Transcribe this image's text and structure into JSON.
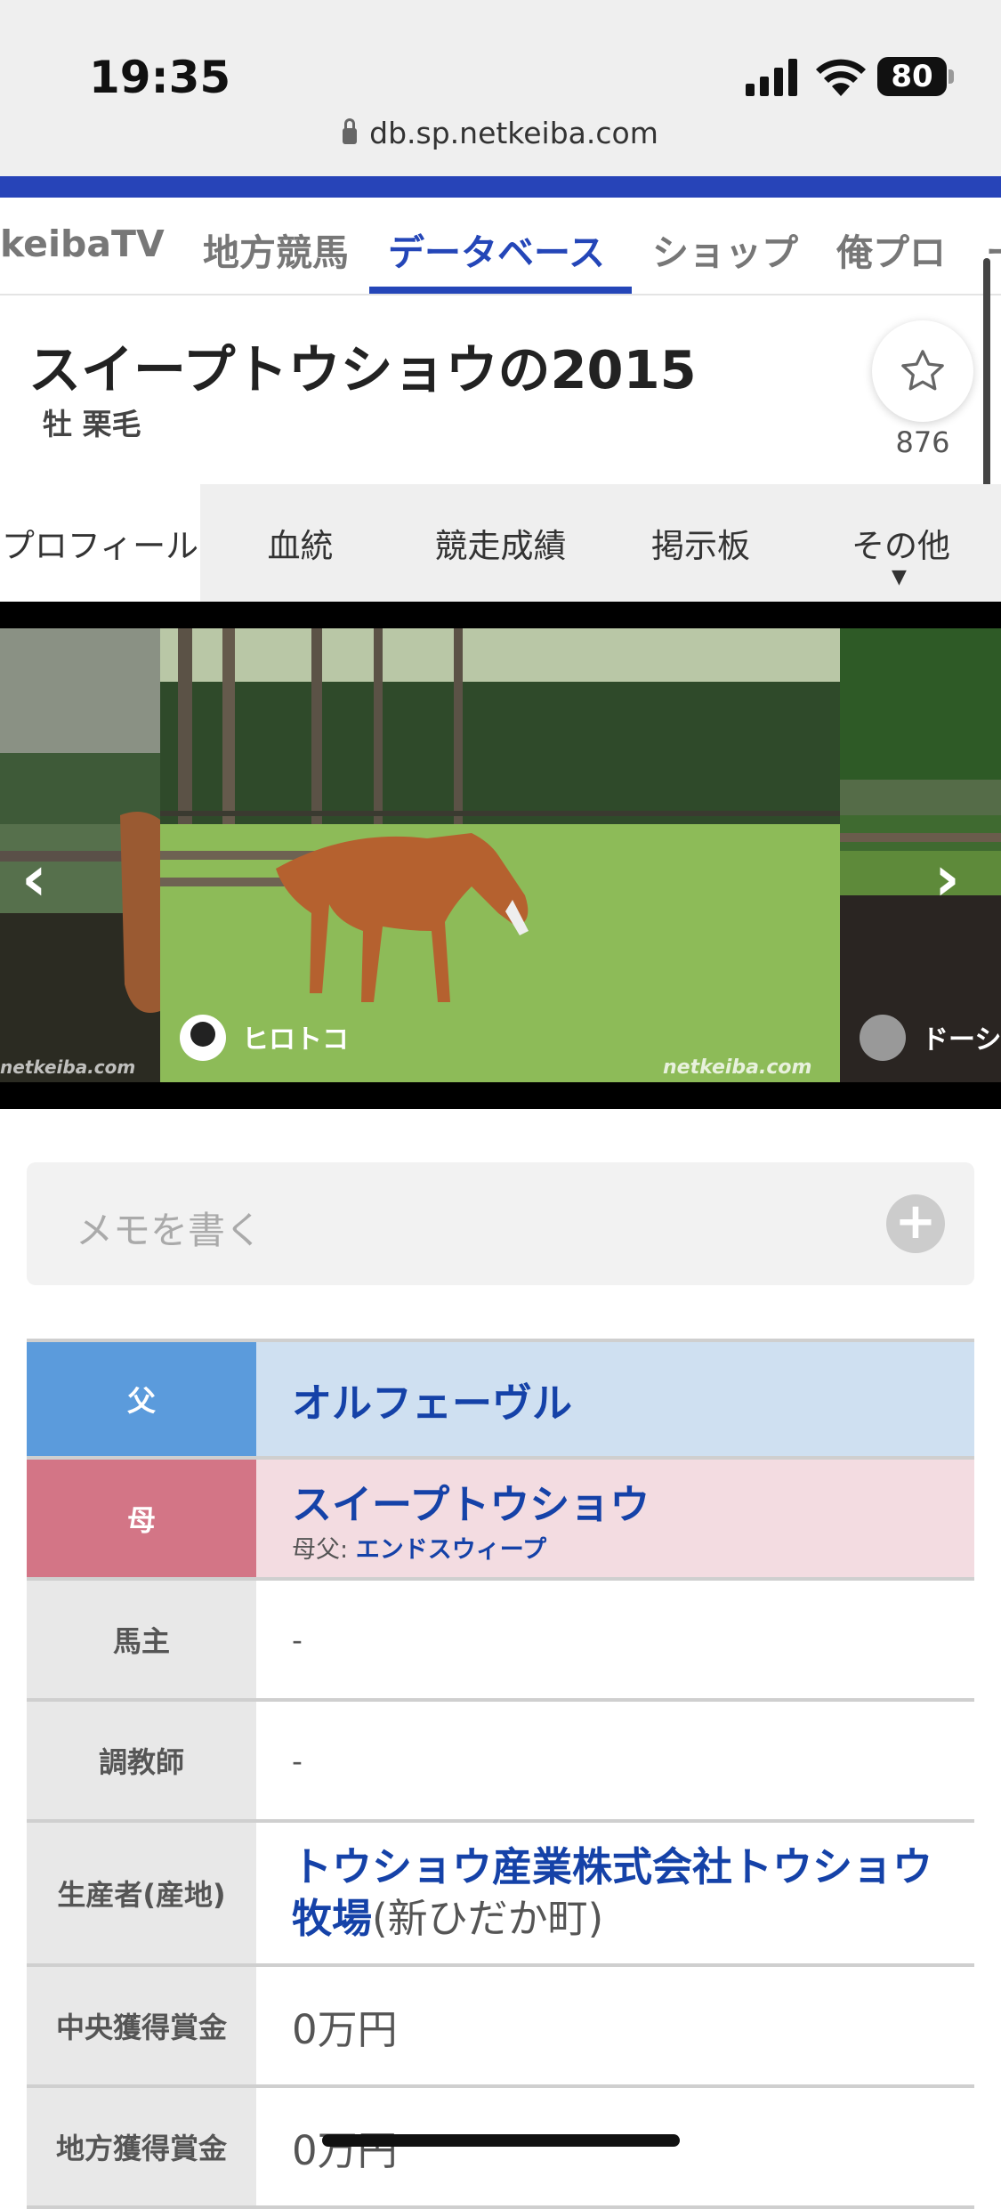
{
  "status": {
    "time": "19:35",
    "battery": "80",
    "url": "db.sp.netkeiba.com"
  },
  "global_nav": {
    "items": [
      "keibaTV",
      "地方競馬",
      "データベース",
      "ショップ",
      "俺プロ",
      "ー"
    ],
    "active": "データベース"
  },
  "horse": {
    "name": "スイープトウショウの2015",
    "sub": "牡  栗毛",
    "fav_count": "876"
  },
  "tabs": [
    "プロフィール",
    "血統",
    "競走成績",
    "掲示板",
    "その他"
  ],
  "gallery": {
    "center_user": "ヒロトコ",
    "right_user": "ドーシ",
    "watermark": "netkeiba.com"
  },
  "memo": {
    "placeholder": "メモを書く"
  },
  "profile": {
    "sire_label": "父",
    "sire": "オルフェーヴル",
    "dam_label": "母",
    "dam": "スイープトウショウ",
    "damsire_label": "母父:",
    "damsire": "エンドスウィープ",
    "owner_label": "馬主",
    "owner": "-",
    "trainer_label": "調教師",
    "trainer": "-",
    "breeder_label": "生産者(産地)",
    "breeder": "トウショウ産業株式会社トウショウ牧場",
    "region": "(新ひだか町)",
    "central_label": "中央獲得賞金",
    "central": "0万円",
    "local_label": "地方獲得賞金",
    "local": "0万円"
  }
}
